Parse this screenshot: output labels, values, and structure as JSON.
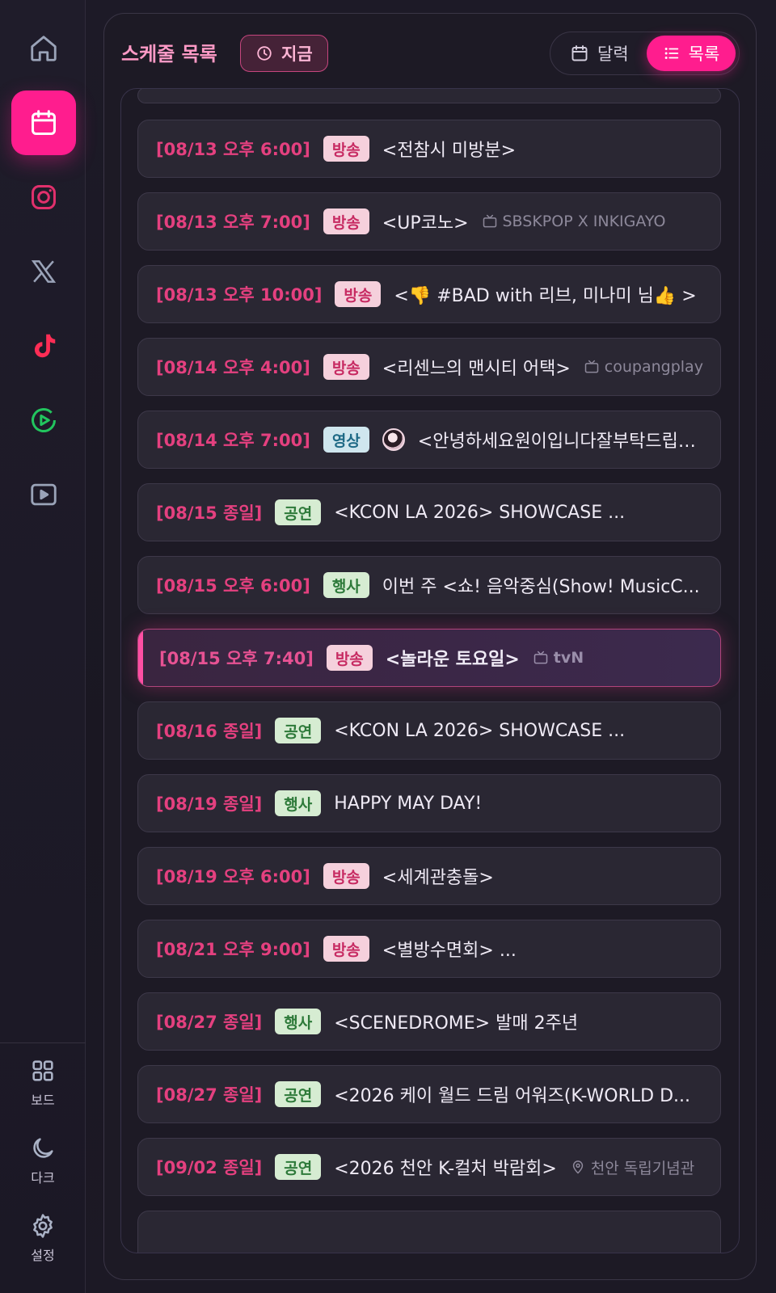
{
  "sidebar": {
    "items": [
      {
        "icon": "home-icon"
      },
      {
        "icon": "calendar-icon",
        "active": true
      },
      {
        "icon": "instagram-icon",
        "color": "#e1306c"
      },
      {
        "icon": "x-icon"
      },
      {
        "icon": "tiktok-icon",
        "color": "#ff2d55"
      },
      {
        "icon": "play-circle-icon",
        "color": "#22c55e"
      },
      {
        "icon": "youtube-icon"
      }
    ],
    "bottom": {
      "board_label": "보드",
      "dark_label": "다크",
      "settings_label": "설정"
    }
  },
  "header": {
    "title": "스케줄 목록",
    "now_label": "지금",
    "calendar_label": "달력",
    "list_label": "목록"
  },
  "accent_color": "#ff1d8e",
  "schedule": [
    {
      "date": "[08/13 오후 6:00]",
      "type": "방송",
      "title": "<전참시 미방분>"
    },
    {
      "date": "[08/13 오후 7:00]",
      "type": "방송",
      "title": "<UP코노>",
      "channel": "SBSKPOP X INKIGAYO"
    },
    {
      "date": "[08/13 오후 10:00]",
      "type": "방송",
      "title": "<👎 #BAD with 리브, 미나미 님👍 >"
    },
    {
      "date": "[08/14 오후 4:00]",
      "type": "방송",
      "title": "<리센느의 맨시티 어택>",
      "channel": "coupangplay"
    },
    {
      "date": "[08/14 오후 7:00]",
      "type": "영상",
      "title": "<안녕하세요원이입니다잘부탁드립니..."
    },
    {
      "date": "[08/15 종일]",
      "type": "공연",
      "title": "<KCON LA 2026> SHOWCASE ..."
    },
    {
      "date": "[08/15 오후 6:00]",
      "type": "행사",
      "title": "이번 주 <쇼! 음악중심(Show! MusicC..."
    },
    {
      "date": "[08/15 오후 7:40]",
      "type": "방송",
      "title": "<놀라운 토요일>",
      "channel": "tvN",
      "current": true
    },
    {
      "date": "[08/16 종일]",
      "type": "공연",
      "title": "<KCON LA 2026> SHOWCASE ..."
    },
    {
      "date": "[08/19 종일]",
      "type": "행사",
      "title": "HAPPY MAY DAY!"
    },
    {
      "date": "[08/19 오후 6:00]",
      "type": "방송",
      "title": "<세계관충돌>"
    },
    {
      "date": "[08/21 오후 9:00]",
      "type": "방송",
      "title": "<별방수면회> ..."
    },
    {
      "date": "[08/27 종일]",
      "type": "행사",
      "title": "<SCENEDROME> 발매 2주년"
    },
    {
      "date": "[08/27 종일]",
      "type": "공연",
      "title": "<2026 케이 월드 드림 어워즈(K-WORLD D..."
    },
    {
      "date": "[09/02 종일]",
      "type": "공연",
      "title": "<2026 천안 K-컬처 박람회>",
      "location": "천안 독립기념관"
    }
  ]
}
